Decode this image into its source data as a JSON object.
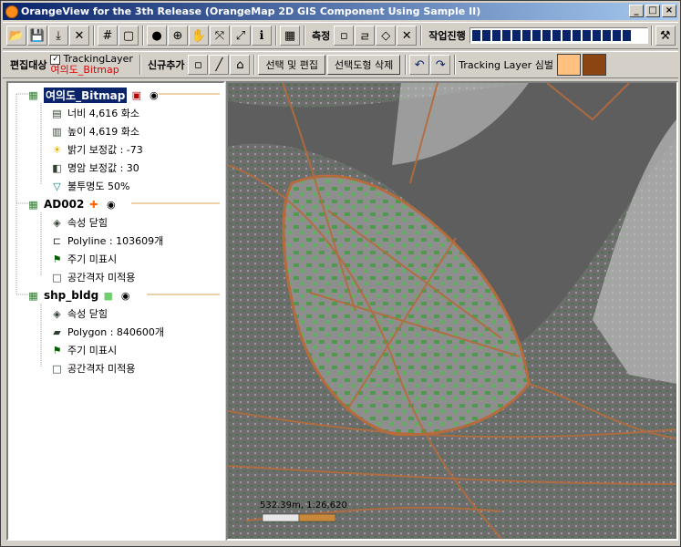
{
  "window": {
    "title": "OrangeView for the 3th Release (OrangeMap 2D GIS Component Using Sample II)",
    "minimize": "_",
    "maximize": "□",
    "close": "×"
  },
  "toolbar1": {
    "measure_label": "측정",
    "progress_label": "작업진행",
    "progress_segments": 16
  },
  "toolbar2": {
    "edit_target_label": "편집대상",
    "tracking_layer_checkbox": "TrackingLayer",
    "tracking_layer_checked": true,
    "current_layer": "여의도_Bitmap",
    "new_add_label": "신규추가",
    "select_edit_button": "선택 및 편집",
    "select_delete_button": "선택도형 삭제",
    "tracking_symbol_label": "Tracking Layer 심벌",
    "swatch_light": "#ffc080",
    "swatch_dark": "#8b4513"
  },
  "tree": {
    "layers": [
      {
        "name": "여의도_Bitmap",
        "children": [
          "너비 4,616 화소",
          "높이 4,619 화소",
          "밝기 보정값 : -73",
          "명암 보정값 : 30",
          "불투명도 50%"
        ]
      },
      {
        "name": "AD002",
        "children": [
          "속성 닫힘",
          "Polyline : 103609개",
          "주기 미표시",
          "공간격자 미적용"
        ]
      },
      {
        "name": "shp_bldg",
        "children": [
          "속성 닫힘",
          "Polygon : 840600개",
          "주기 미표시",
          "공간격자 미적용"
        ]
      }
    ]
  },
  "map": {
    "scale_text": "532.39m, 1:26,620"
  }
}
